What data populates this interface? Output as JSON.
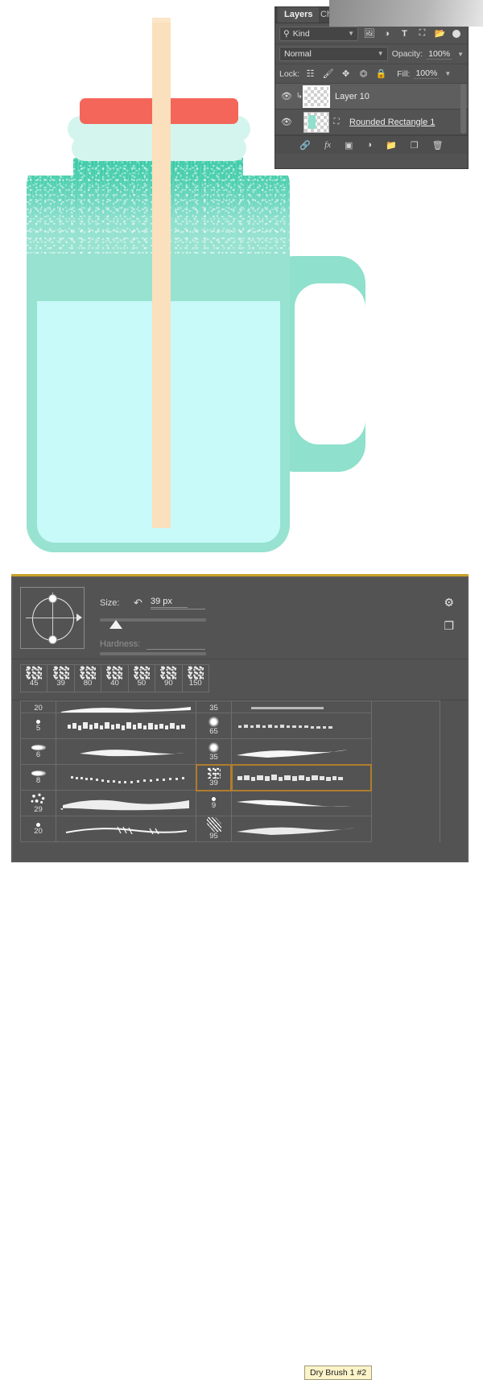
{
  "app": "Adobe Photoshop",
  "canvas": {
    "illustration_name": "mason-jar-with-straw",
    "colors": {
      "jar_body": "#97E2D0",
      "jar_top_texture": "#37C9A6",
      "liquid": "#C8FAFA",
      "lid_band": "#D4F5EE",
      "lid_cap": "#F4665A",
      "straw": "#FAE0BC",
      "background": "#FFFFFF"
    }
  },
  "layers_panel": {
    "tabs": [
      {
        "label": "Layers",
        "active": true
      },
      {
        "label": "Ch",
        "active": false
      }
    ],
    "filter": {
      "kind_label": "Kind",
      "icons": [
        "pixel-layer-filter-icon",
        "adjustment-layer-filter-icon",
        "type-layer-filter-icon",
        "shape-layer-filter-icon",
        "smart-object-filter-icon"
      ],
      "toggle": "filter-toggle-icon"
    },
    "blend": {
      "mode": "Normal",
      "opacity_label": "Opacity:",
      "opacity_value": "100%"
    },
    "lock": {
      "label": "Lock:",
      "buttons": [
        "lock-transparent-pixels-icon",
        "lock-image-pixels-icon",
        "lock-position-icon",
        "lock-artboard-nesting-icon",
        "lock-all-icon"
      ],
      "fill_label": "Fill:",
      "fill_value": "100%"
    },
    "layers": [
      {
        "name": "Layer 10",
        "visible": true,
        "selected": true,
        "clipped": true,
        "thumb": "transparent-checker",
        "underline": false
      },
      {
        "name": "Rounded Rectangle 1",
        "visible": true,
        "selected": false,
        "clipped": false,
        "thumb": "shape-thumbnail",
        "underline": true
      }
    ],
    "footer_buttons": [
      "link-layers-icon",
      "layer-style-fx-icon",
      "add-layer-mask-icon",
      "new-adjustment-layer-icon",
      "new-group-icon",
      "new-layer-icon",
      "delete-layer-icon"
    ],
    "footer_labels": {
      "fx": "fx"
    }
  },
  "brush_panel": {
    "size": {
      "label": "Size:",
      "reset_icon": "reset-arrow-icon",
      "value": "39 px",
      "slider_percent": 11
    },
    "hardness": {
      "label": "Hardness:",
      "value": "",
      "slider_percent": 0,
      "disabled": true
    },
    "gear_icon": "gear-icon",
    "new_preset_icon": "new-preset-icon",
    "preset_strip": [
      {
        "size": "45"
      },
      {
        "size": "39"
      },
      {
        "size": "80"
      },
      {
        "size": "40"
      },
      {
        "size": "50"
      },
      {
        "size": "90"
      },
      {
        "size": "150"
      }
    ],
    "brush_list": {
      "column_a": [
        {
          "size": "20",
          "glyph": "speckle",
          "partial": true
        },
        {
          "size": "5",
          "glyph": "dot"
        },
        {
          "size": "6",
          "glyph": "smear"
        },
        {
          "size": "8",
          "glyph": "smear"
        },
        {
          "size": "29",
          "glyph": "cloud"
        },
        {
          "size": "20",
          "glyph": "dot"
        }
      ],
      "column_b": [
        {
          "size": "35",
          "glyph": "bigdot",
          "partial": true
        },
        {
          "size": "65",
          "glyph": "bigdot"
        },
        {
          "size": "35",
          "glyph": "bigdot"
        },
        {
          "size": "39",
          "glyph": "speckle",
          "selected": true
        },
        {
          "size": "9",
          "glyph": "dot"
        },
        {
          "size": "95",
          "glyph": "diag"
        }
      ]
    },
    "tooltip": "Dry Brush 1 #2",
    "selected_brush_name": "Dry Brush 1 #2",
    "accent_color": "#B07D2E",
    "panel_top_border_color": "#C9A227"
  }
}
